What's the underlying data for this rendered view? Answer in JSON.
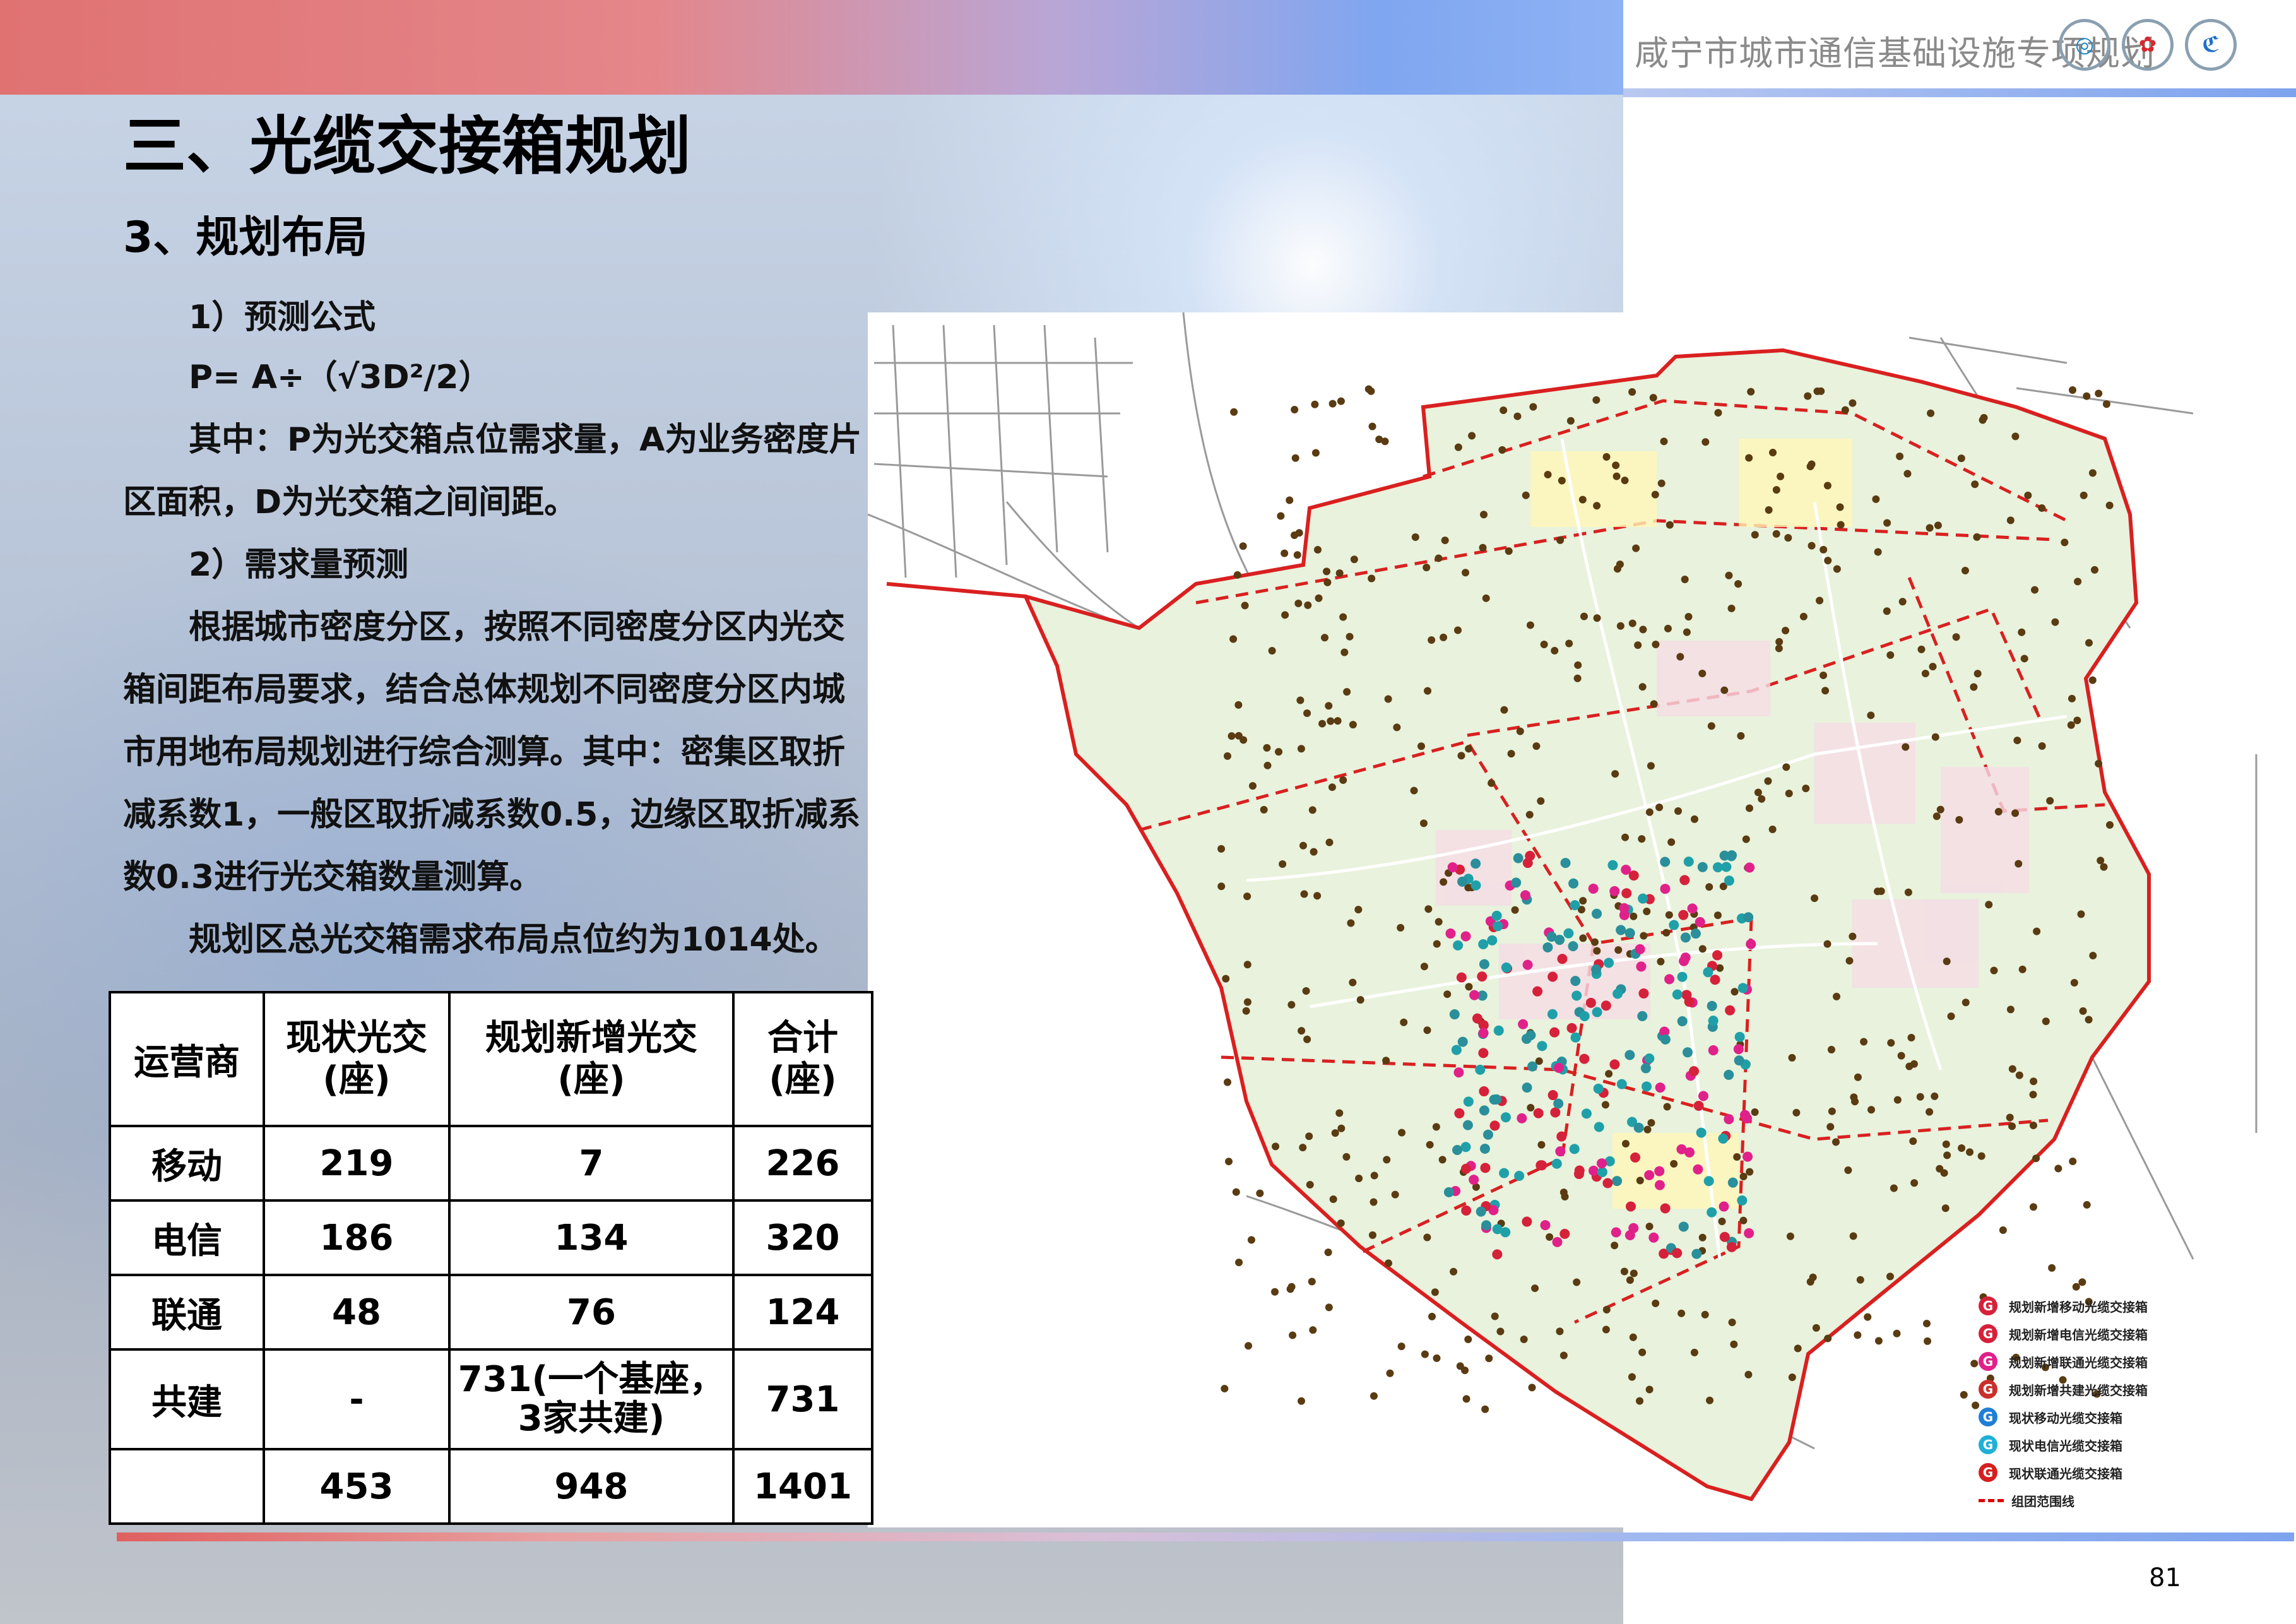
{
  "header": {
    "title": "咸宁市城市通信基础设施专项规划",
    "logos": [
      {
        "name": "china-mobile-logo",
        "glyph": "◎",
        "color": "#1d8ac7"
      },
      {
        "name": "china-unicom-logo",
        "glyph": "✿",
        "color": "#d8262e"
      },
      {
        "name": "china-telecom-logo",
        "glyph": "ℭ",
        "color": "#1d6fc7"
      }
    ]
  },
  "main": {
    "title": "三、光缆交接箱规划",
    "subtitle": "3、规划布局",
    "paragraphs": [
      "　　1）预测公式",
      "　　P= A÷（√3D²/2）",
      "　　其中：P为光交箱点位需求量，A为业务密度片区面积，D为光交箱之间间距。",
      "　　2）需求量预测",
      "　　根据城市密度分区，按照不同密度分区内光交箱间距布局要求，结合总体规划不同密度分区内城市用地布局规划进行综合测算。其中：密集区取折减系数1，一般区取折减系数0.5，边缘区取折减系数0.3进行光交箱数量测算。",
      "　　规划区总光交箱需求布局点位约为1014处。"
    ]
  },
  "table": {
    "headers": [
      "运营商",
      "现状光交\n(座)",
      "规划新增光交\n(座)",
      "合计\n(座)"
    ],
    "rows": [
      [
        "移动",
        "219",
        "7",
        "226"
      ],
      [
        "电信",
        "186",
        "134",
        "320"
      ],
      [
        "联通",
        "48",
        "76",
        "124"
      ],
      [
        "共建",
        "-",
        "731(一个基座，\n3家共建)",
        "731"
      ],
      [
        "",
        "453",
        "948",
        "1401"
      ]
    ]
  },
  "legend": [
    {
      "label": "规划新增移动光缆交接箱",
      "color": "#d6213a",
      "glyph": "G"
    },
    {
      "label": "规划新增电信光缆交接箱",
      "color": "#d6213a",
      "glyph": "G"
    },
    {
      "label": "规划新增联通光缆交接箱",
      "color": "#e0218a",
      "glyph": "G"
    },
    {
      "label": "规划新增共建光缆交接箱",
      "color": "#c9302c",
      "glyph": "G"
    },
    {
      "label": "现状移动光缆交接箱",
      "color": "#1f7fd6",
      "glyph": "G"
    },
    {
      "label": "现状电信光缆交接箱",
      "color": "#1fb0d6",
      "glyph": "G"
    },
    {
      "label": "现状联通光缆交接箱",
      "color": "#d61f1f",
      "glyph": "G"
    },
    {
      "label": "组团范围线",
      "color": "#d00000",
      "glyph": ""
    }
  ],
  "page_number": "81"
}
